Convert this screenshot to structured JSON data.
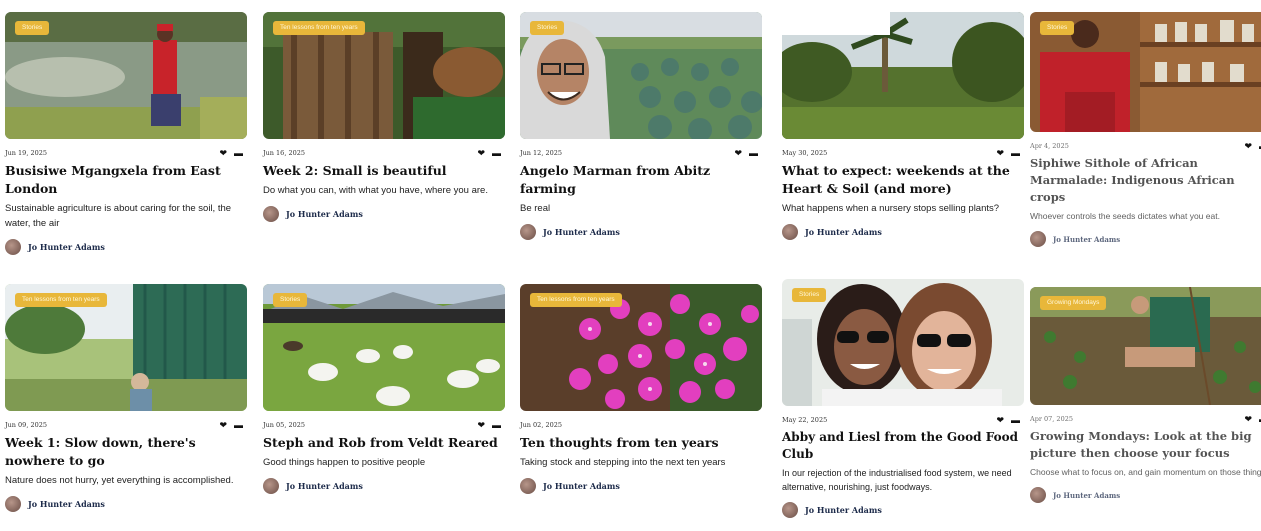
{
  "cards": [
    {
      "tag": "Stories",
      "date": "Jun 19, 2025",
      "title": "Busisiwe Mgangxela from East London",
      "excerpt": "Sustainable agriculture is about caring for the soil, the water, the air",
      "author": "Jo Hunter Adams"
    },
    {
      "tag": "Ten lessons from ten years",
      "date": "Jun 16, 2025",
      "title": "Week 2: Small is beautiful",
      "excerpt": "Do what you can, with what you have, where you are.",
      "author": "Jo Hunter Adams"
    },
    {
      "tag": "Stories",
      "date": "Jun 12, 2025",
      "title": "Angelo Marman from Abitz farming",
      "excerpt": "Be real",
      "author": "Jo Hunter Adams"
    },
    {
      "tag": "",
      "date": "May 30, 2025",
      "title": "What to expect: weekends at the Heart & Soil (and more)",
      "excerpt": "What happens when a nursery stops selling plants?",
      "author": "Jo Hunter Adams"
    },
    {
      "tag": "Stories",
      "date": "Apr 4, 2025",
      "title": "Siphiwe Sithole of African Marmalade: Indigenous African crops",
      "excerpt": "Whoever controls the seeds dictates what you eat.",
      "author": "Jo Hunter Adams"
    },
    {
      "tag": "Ten lessons from ten years",
      "date": "Jun 09, 2025",
      "title": "Week 1: Slow down, there's nowhere to go",
      "excerpt": "Nature does not hurry, yet everything is accomplished.",
      "author": "Jo Hunter Adams"
    },
    {
      "tag": "Stories",
      "date": "Jun 05, 2025",
      "title": "Steph and Rob from Veldt Reared",
      "excerpt": "Good things happen to positive people",
      "author": "Jo Hunter Adams"
    },
    {
      "tag": "Ten lessons from ten years",
      "date": "Jun 02, 2025",
      "title": "Ten thoughts from ten years",
      "excerpt": "Taking stock and stepping into the next ten years",
      "author": "Jo Hunter Adams"
    },
    {
      "tag": "Stories",
      "date": "May 22, 2025",
      "title": "Abby and Liesl from the Good Food Club",
      "excerpt": "In our rejection of the industrialised food system, we need alternative, nourishing, just foodways.",
      "author": "Jo Hunter Adams"
    },
    {
      "tag": "Growing Mondays",
      "date": "Apr 07, 2025",
      "title": "Growing Mondays: Look at the big picture then choose your focus",
      "excerpt": "Choose what to focus on, and gain momentum on those things",
      "author": "Jo Hunter Adams"
    }
  ],
  "icons": {
    "like": "heart-icon",
    "comment": "comment-bubble-icon"
  },
  "colors": {
    "tag": "#e8b73a",
    "author": "#1d2b4a"
  }
}
